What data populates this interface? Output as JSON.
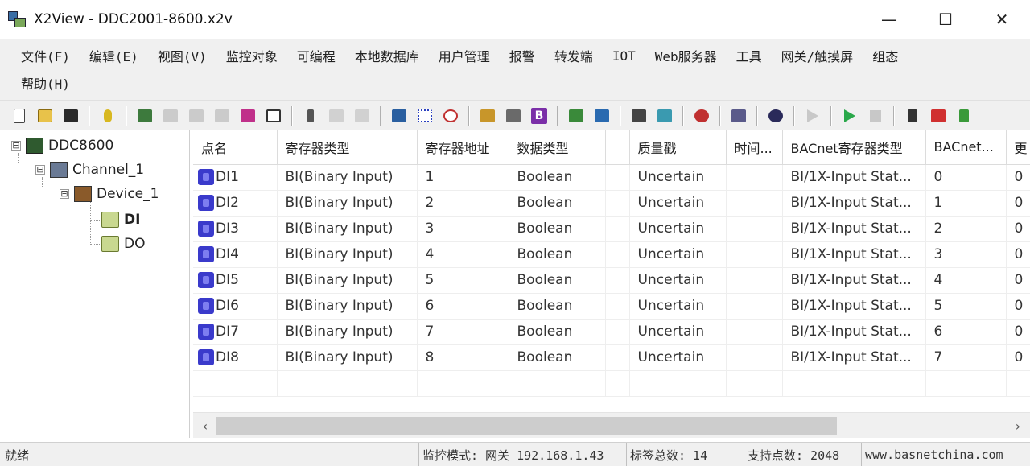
{
  "window": {
    "title": "X2View - DDC2001-8600.x2v",
    "minimize_glyph": "—",
    "maximize_glyph": "☐",
    "close_glyph": "✕"
  },
  "menu": {
    "row1": [
      "文件(F)",
      "编辑(E)",
      "视图(V)",
      "监控对象",
      "可编程",
      "本地数据库",
      "用户管理",
      "报警",
      "转发端",
      "IOT",
      "Web服务器",
      "工具",
      "网关/触摸屏",
      "组态"
    ],
    "row2": [
      "帮助(H)"
    ]
  },
  "toolbar": {
    "icons": [
      "new-file-icon",
      "open-folder-icon",
      "save-icon",
      "help-icon",
      "grid-icon",
      "cut-tool-icon",
      "disabled-doc-icon",
      "disabled-edit-icon",
      "cube-icon",
      "window-icon",
      "scissors-icon",
      "copy-icon",
      "paste-icon",
      "book-icon",
      "table-grid-icon",
      "timer-icon",
      "person-icon",
      "device-icon",
      "b-icon",
      "chart-icon",
      "export-icon",
      "monitor-icon",
      "route-icon",
      "alarm-icon",
      "db-icon",
      "eye-icon",
      "play-disabled-icon",
      "play-icon",
      "stop-icon",
      "hammer-icon",
      "bug-icon",
      "arrows-icon"
    ],
    "b_letter": "B"
  },
  "tree": {
    "root": "DDC8600",
    "channel": "Channel_1",
    "device": "Device_1",
    "folders": [
      "DI",
      "DO"
    ],
    "toggle": "⊟"
  },
  "table": {
    "columns": [
      "点名",
      "寄存器类型",
      "寄存器地址",
      "数据类型",
      "",
      "质量戳",
      "时间...",
      "BACnet寄存器类型",
      "BACnet...",
      "更"
    ],
    "rows": [
      [
        "DI1",
        "BI(Binary Input)",
        "1",
        "Boolean",
        "",
        "Uncertain",
        "",
        "BI/1X-Input Stat...",
        "0",
        "0"
      ],
      [
        "DI2",
        "BI(Binary Input)",
        "2",
        "Boolean",
        "",
        "Uncertain",
        "",
        "BI/1X-Input Stat...",
        "1",
        "0"
      ],
      [
        "DI3",
        "BI(Binary Input)",
        "3",
        "Boolean",
        "",
        "Uncertain",
        "",
        "BI/1X-Input Stat...",
        "2",
        "0"
      ],
      [
        "DI4",
        "BI(Binary Input)",
        "4",
        "Boolean",
        "",
        "Uncertain",
        "",
        "BI/1X-Input Stat...",
        "3",
        "0"
      ],
      [
        "DI5",
        "BI(Binary Input)",
        "5",
        "Boolean",
        "",
        "Uncertain",
        "",
        "BI/1X-Input Stat...",
        "4",
        "0"
      ],
      [
        "DI6",
        "BI(Binary Input)",
        "6",
        "Boolean",
        "",
        "Uncertain",
        "",
        "BI/1X-Input Stat...",
        "5",
        "0"
      ],
      [
        "DI7",
        "BI(Binary Input)",
        "7",
        "Boolean",
        "",
        "Uncertain",
        "",
        "BI/1X-Input Stat...",
        "6",
        "0"
      ],
      [
        "DI8",
        "BI(Binary Input)",
        "8",
        "Boolean",
        "",
        "Uncertain",
        "",
        "BI/1X-Input Stat...",
        "7",
        "0"
      ]
    ]
  },
  "scroll": {
    "left_glyph": "‹",
    "right_glyph": "›"
  },
  "status": {
    "ready": "就绪",
    "mode": "监控模式: 网关 192.168.1.43",
    "tag_count": "标签总数: 14",
    "support_points": "支持点数: 2048",
    "website": "www.basnetchina.com"
  },
  "colors": {
    "play": "#2aa84a",
    "b_badge": "#7b2fa8",
    "point_icon": "#3a3acb"
  }
}
